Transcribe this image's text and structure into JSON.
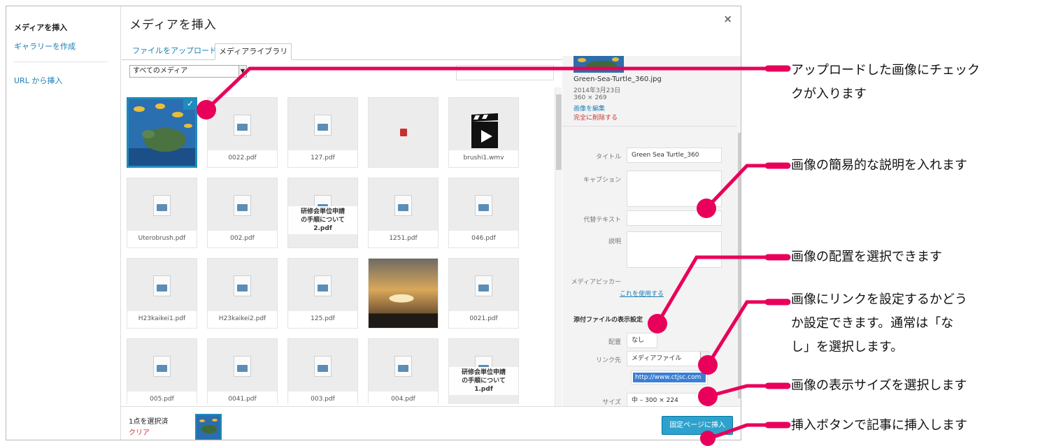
{
  "modal": {
    "title": "メディアを挿入",
    "close": "×"
  },
  "menu": {
    "insert_media": "メディアを挿入",
    "create_gallery": "ギャラリーを作成",
    "insert_from_url": "URL から挿入"
  },
  "tabs": {
    "upload": "ファイルをアップロード",
    "library": "メディアライブラリ"
  },
  "filter": {
    "value": "すべてのメディア"
  },
  "grid": {
    "items": [
      {
        "type": "image-turtle",
        "name": "",
        "selected": true
      },
      {
        "type": "doc",
        "name": "0022.pdf"
      },
      {
        "type": "doc",
        "name": "127.pdf"
      },
      {
        "type": "pdf",
        "name": ""
      },
      {
        "type": "video",
        "name": "brushi1.wmv"
      },
      {
        "type": "doc",
        "name": "Uterobrush.pdf"
      },
      {
        "type": "doc",
        "name": "002.pdf"
      },
      {
        "type": "doc-multi",
        "name": "研修会単位申請\nの手順について\n2.pdf"
      },
      {
        "type": "doc",
        "name": "1251.pdf"
      },
      {
        "type": "doc",
        "name": "046.pdf"
      },
      {
        "type": "doc",
        "name": "H23kaikei1.pdf"
      },
      {
        "type": "doc",
        "name": "H23kaikei2.pdf"
      },
      {
        "type": "doc",
        "name": "125.pdf"
      },
      {
        "type": "image-sunset",
        "name": ""
      },
      {
        "type": "doc",
        "name": "0021.pdf"
      },
      {
        "type": "doc",
        "name": "005.pdf"
      },
      {
        "type": "doc",
        "name": "0041.pdf"
      },
      {
        "type": "doc",
        "name": "003.pdf"
      },
      {
        "type": "doc",
        "name": "004.pdf"
      },
      {
        "type": "doc-multi",
        "name": "研修会単位申請\nの手順について\n1.pdf"
      }
    ]
  },
  "attachment": {
    "filename": "Green-Sea-Turtle_360.jpg",
    "date": "2014年3月23日",
    "dimensions": "360 × 269",
    "edit_link": "画像を編集",
    "delete_link": "完全に削除する",
    "title_label": "タイトル",
    "title_value": "Green Sea Turtle_360",
    "caption_label": "キャプション",
    "alt_label": "代替テキスト",
    "description_label": "説明",
    "media_picker_label": "メディアピッカー",
    "use_this_link": "これを使用する",
    "display_settings_heading": "添付ファイルの表示設定",
    "align_label": "配置",
    "align_value": "なし",
    "link_label": "リンク先",
    "link_value": "メディアファイル",
    "link_url": "http://www.ctjsc.com",
    "size_label": "サイズ",
    "size_value": "中 – 300 × 224"
  },
  "footer": {
    "selected_count": "1点を選択済",
    "clear": "クリア",
    "insert_button": "固定ページに挿入"
  },
  "annotations": {
    "check": "アップロードした画像にチェック\nクが入ります",
    "caption": "画像の簡易的な説明を入れます",
    "align": "画像の配置を選択できます",
    "link": "画像にリンクを設定するかどう\nか設定できます。通常は「な\nし」を選択します。",
    "size": "画像の表示サイズを選択します",
    "insert": "挿入ボタンで記事に挿入します"
  },
  "colors": {
    "accent": "#1e8cbe",
    "annotation": "#e8005a",
    "button": "#2ea2cc"
  }
}
